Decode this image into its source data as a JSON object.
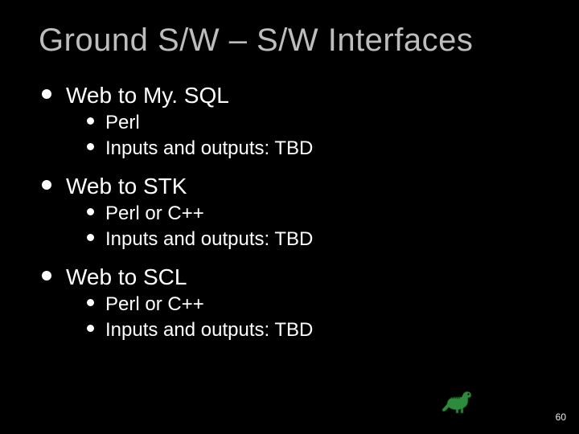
{
  "title": "Ground S/W – S/W Interfaces",
  "groups": [
    {
      "heading": "Web to My. SQL",
      "items": [
        "Perl",
        "Inputs and outputs: TBD"
      ]
    },
    {
      "heading": "Web to STK",
      "items": [
        "Perl or C++",
        "Inputs and outputs: TBD"
      ]
    },
    {
      "heading": "Web to SCL",
      "items": [
        "Perl or C++",
        "Inputs and outputs: TBD"
      ]
    }
  ],
  "page_number": "60"
}
